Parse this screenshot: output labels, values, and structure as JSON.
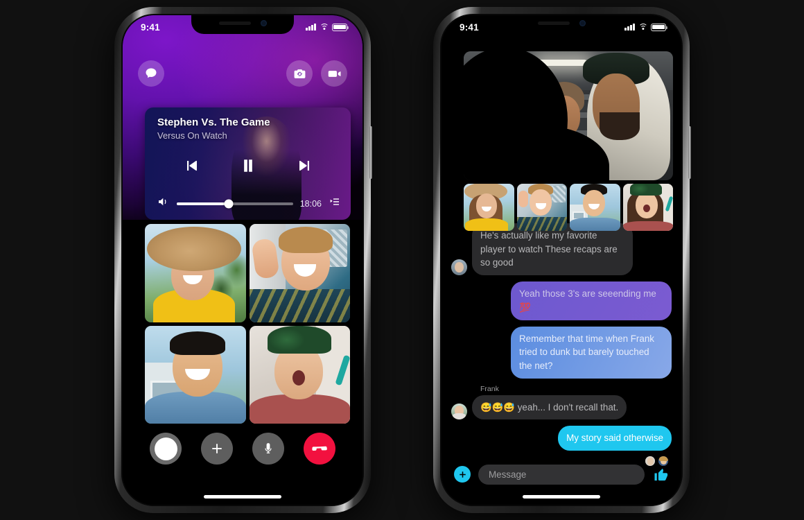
{
  "left_phone": {
    "status_bar": {
      "time": "9:41",
      "signal_icon": "cellular-bars-icon",
      "wifi_icon": "wifi-icon",
      "battery_icon": "battery-full-icon"
    },
    "header": {
      "chat_button_icon": "chat-bubble-icon",
      "flip_camera_button_icon": "flip-camera-icon",
      "video_button_icon": "video-camera-icon"
    },
    "media_card": {
      "title": "Stephen Vs. The Game",
      "subtitle": "Versus On Watch",
      "previous_icon": "skip-previous-icon",
      "play_pause_icon": "pause-icon",
      "next_icon": "skip-next-icon",
      "volume_icon": "volume-up-icon",
      "volume_percent": 45,
      "time_remaining": "18:06",
      "playlist_icon": "playlist-icon"
    },
    "participants": [
      {
        "name": "participant-1"
      },
      {
        "name": "participant-2"
      },
      {
        "name": "participant-3"
      },
      {
        "name": "participant-4"
      }
    ],
    "call_controls": [
      {
        "name": "capture-button",
        "icon": "shutter-icon"
      },
      {
        "name": "add-effects-button",
        "icon": "plus-icon"
      },
      {
        "name": "mute-button",
        "icon": "microphone-icon"
      },
      {
        "name": "end-call-button",
        "icon": "hang-up-icon"
      }
    ],
    "colors": {
      "accent": "#7a17c6",
      "end_call": "#f2113f"
    }
  },
  "right_phone": {
    "status_bar": {
      "time": "9:41",
      "signal_icon": "cellular-bars-icon",
      "wifi_icon": "wifi-icon",
      "battery_icon": "battery-full-icon"
    },
    "video_thumbnails": [
      {
        "name": "thumbnail-1"
      },
      {
        "name": "thumbnail-2"
      },
      {
        "name": "thumbnail-3"
      },
      {
        "name": "thumbnail-4"
      }
    ],
    "messages": [
      {
        "id": "m1",
        "align": "left",
        "style": "grey",
        "sender": "",
        "has_avatar": true,
        "text": "He's actually like my favorite player to watch These recaps are so good"
      },
      {
        "id": "m2",
        "align": "right",
        "style": "purple",
        "sender": "",
        "has_avatar": false,
        "text": "Yeah those 3's are seeending me 💯"
      },
      {
        "id": "m3",
        "align": "right",
        "style": "blue",
        "sender": "",
        "has_avatar": false,
        "text": "Remember that time when Frank tried to dunk but barely touched the net?"
      },
      {
        "id": "m4",
        "align": "left",
        "style": "grey",
        "sender": "Frank",
        "has_avatar": true,
        "text": "😅😅😅 yeah... I don't recall that."
      },
      {
        "id": "m5",
        "align": "right",
        "style": "cyan",
        "sender": "",
        "has_avatar": false,
        "text": "My story said otherwise"
      }
    ],
    "reactions": [
      {
        "name": "seen-avatar-1"
      },
      {
        "name": "seen-avatar-2"
      }
    ],
    "composer": {
      "add_icon": "plus-circle-icon",
      "input_placeholder": "Message",
      "input_value": "",
      "like_icon": "thumbs-up-icon"
    },
    "colors": {
      "accent": "#1fc7ef",
      "bubble_purple": "#7b5bd1",
      "bubble_blue": "#5b8de0",
      "bubble_grey": "#2b2b2d"
    }
  }
}
